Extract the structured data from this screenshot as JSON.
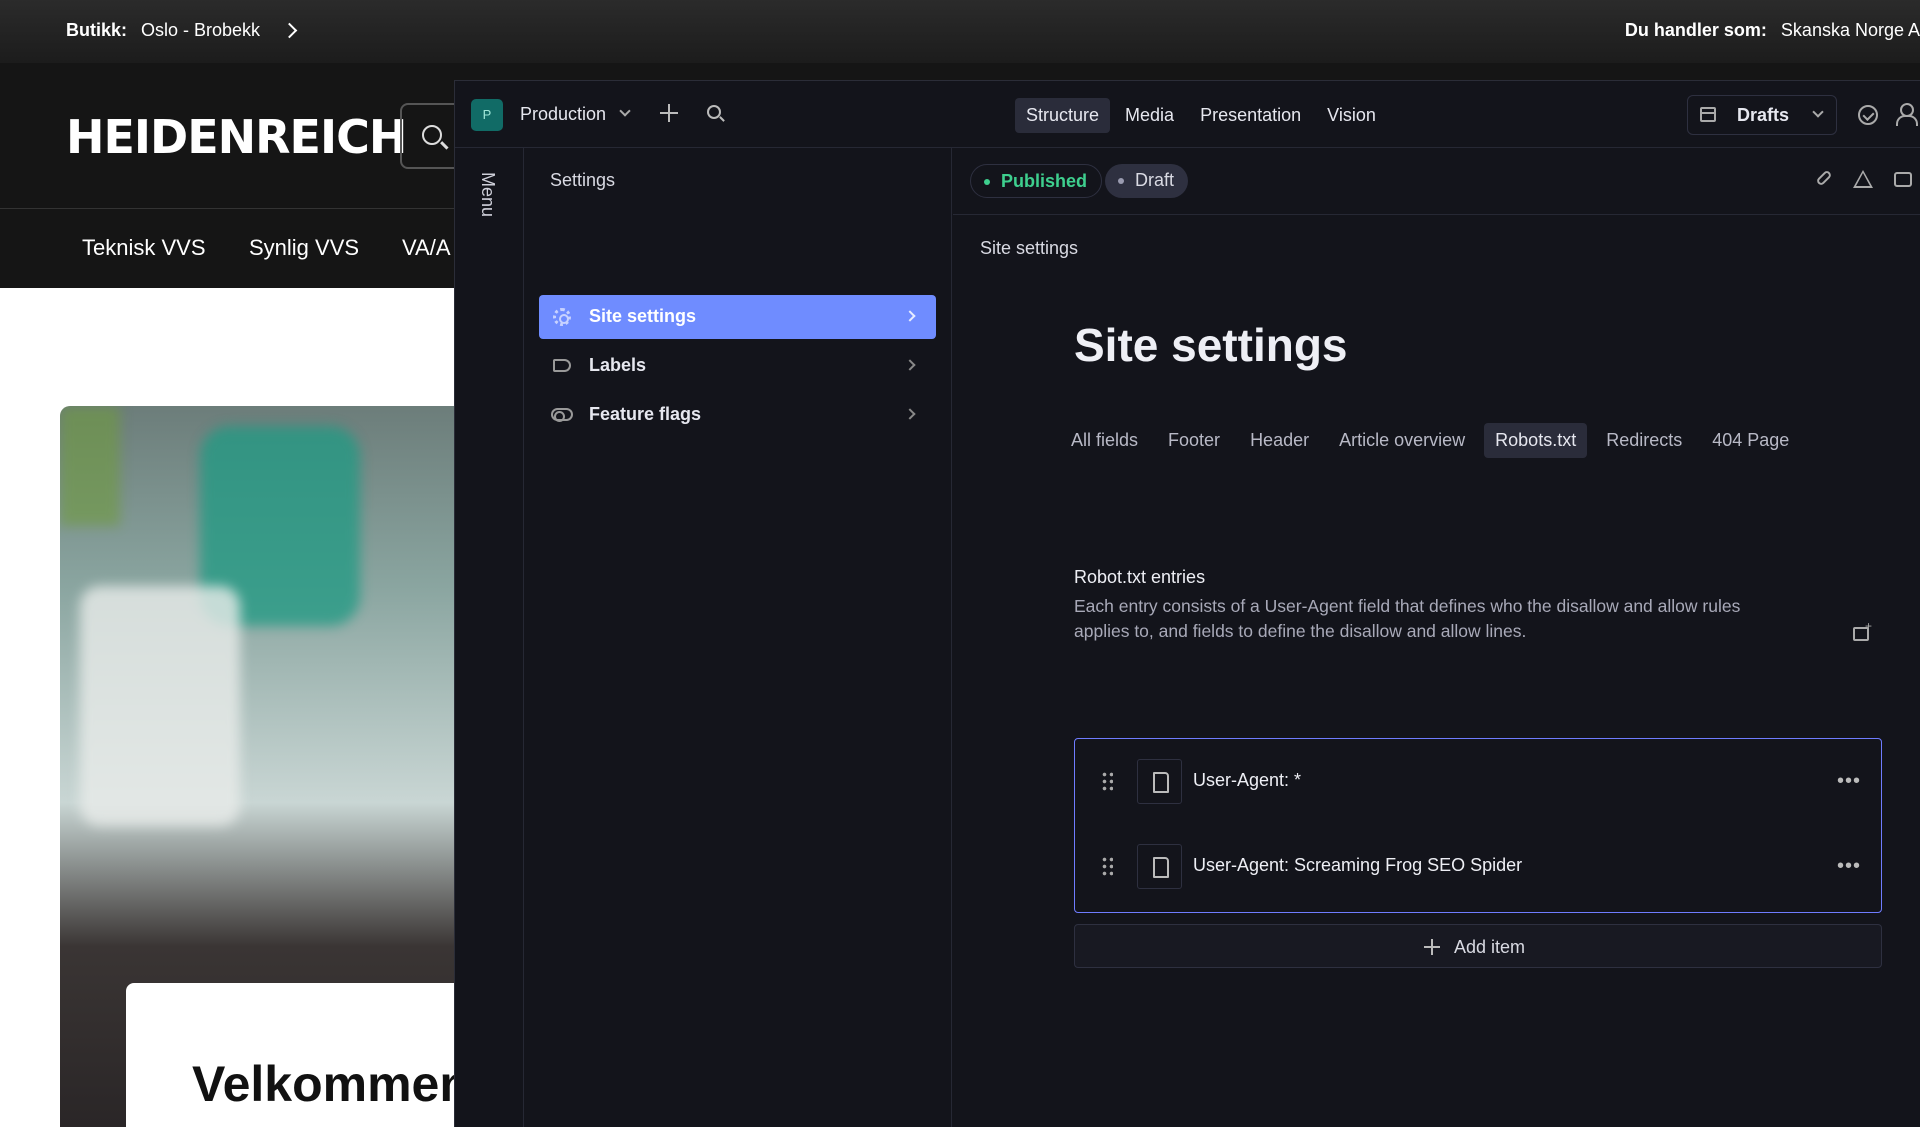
{
  "store_topbar": {
    "store_label": "Butikk:",
    "store_name": "Oslo - Brobekk",
    "customer_label": "Du handler som:",
    "customer_name": "Skanska Norge A"
  },
  "store_header": {
    "logo": "HEIDENREICH",
    "nav": [
      "Teknisk VVS",
      "Synlig VVS",
      "VA/A"
    ]
  },
  "hero": {
    "welcome": "Velkommen"
  },
  "cms": {
    "workspace": {
      "badge": "P",
      "name": "Production"
    },
    "tools": [
      {
        "label": "Structure",
        "active": true
      },
      {
        "label": "Media",
        "active": false
      },
      {
        "label": "Presentation",
        "active": false
      },
      {
        "label": "Vision",
        "active": false
      }
    ],
    "release_selector": "Drafts",
    "menu_label": "Menu",
    "settings_pane": {
      "title": "Settings",
      "items": [
        {
          "label": "Site settings",
          "icon": "gear-icon",
          "active": true
        },
        {
          "label": "Labels",
          "icon": "label-icon",
          "active": false
        },
        {
          "label": "Feature flags",
          "icon": "toggle-icon",
          "active": false
        }
      ]
    },
    "document": {
      "status_published": "Published",
      "status_draft": "Draft",
      "breadcrumb": "Site settings",
      "title": "Site settings",
      "field_groups": [
        {
          "label": "All fields",
          "active": false
        },
        {
          "label": "Footer",
          "active": false
        },
        {
          "label": "Header",
          "active": false
        },
        {
          "label": "Article overview",
          "active": false
        },
        {
          "label": "Robots.txt",
          "active": true
        },
        {
          "label": "Redirects",
          "active": false
        },
        {
          "label": "404 Page",
          "active": false
        }
      ],
      "field": {
        "label": "Robot.txt entries",
        "description": "Each entry consists of a User-Agent field that defines who the disallow and allow rules applies to, and fields to define the disallow and allow lines.",
        "items": [
          "User-Agent: *",
          "User-Agent: Screaming Frog SEO Spider"
        ],
        "add_label": "Add item"
      }
    }
  },
  "colors": {
    "cms_background": "#13141b",
    "selected_item": "#6f8cff",
    "published": "#3ecf8e",
    "array_border": "#6f7cff"
  }
}
